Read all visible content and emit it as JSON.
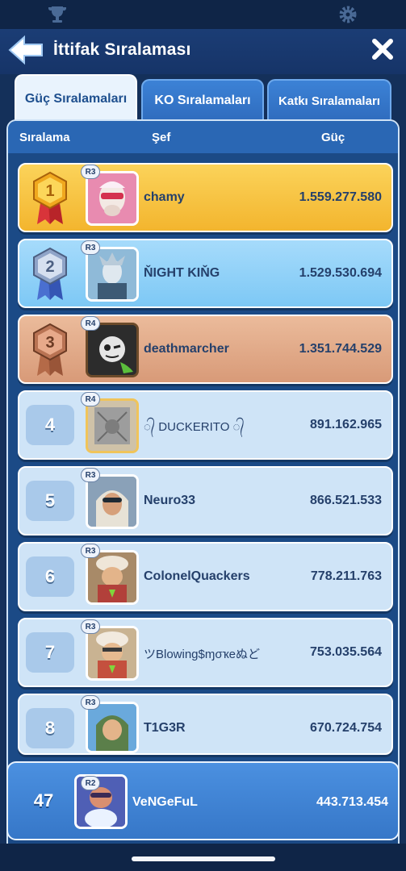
{
  "header": {
    "title": "İttifak Sıralaması"
  },
  "tabs": [
    {
      "label": "Güç Sıralamaları",
      "active": true
    },
    {
      "label": "KO Sıralamaları",
      "active": false
    },
    {
      "label": "Katkı Sıralamaları",
      "active": false
    }
  ],
  "columns": {
    "rank": "Sıralama",
    "chief": "Şef",
    "power": "Güç"
  },
  "rows": [
    {
      "rank": "1",
      "role": "R3",
      "name": "chamy",
      "power": "1.559.277.580",
      "style": "gold"
    },
    {
      "rank": "2",
      "role": "R3",
      "name": "ŇIGHT KIŇG",
      "power": "1.529.530.694",
      "style": "silver"
    },
    {
      "rank": "3",
      "role": "R4",
      "name": "deathmarcher",
      "power": "1.351.744.529",
      "style": "bronze"
    },
    {
      "rank": "4",
      "role": "R4",
      "name": "᭄ DUCKERITO ᭄",
      "power": "891.162.965",
      "style": "plain"
    },
    {
      "rank": "5",
      "role": "R3",
      "name": "Neuro33",
      "power": "866.521.533",
      "style": "plain"
    },
    {
      "rank": "6",
      "role": "R3",
      "name": "ColonelQuackers",
      "power": "778.211.763",
      "style": "plain"
    },
    {
      "rank": "7",
      "role": "R3",
      "name": "ツBlowing$ɱσҡeぬど",
      "power": "753.035.564",
      "style": "plain"
    },
    {
      "rank": "8",
      "role": "R3",
      "name": "T1G3R",
      "power": "670.724.754",
      "style": "plain"
    }
  ],
  "mine": {
    "rank": "47",
    "role": "R2",
    "name": "VeNGeFuL",
    "power": "443.713.454"
  },
  "colors": {
    "gold": "#f3b52e",
    "silver": "#7dc8f5",
    "bronze": "#d89a78",
    "panel": "#1b4a86"
  },
  "icons": {
    "top_left": "trophy-icon",
    "top_right": "gear-icon",
    "back": "back-arrow-icon",
    "close": "close-icon"
  }
}
